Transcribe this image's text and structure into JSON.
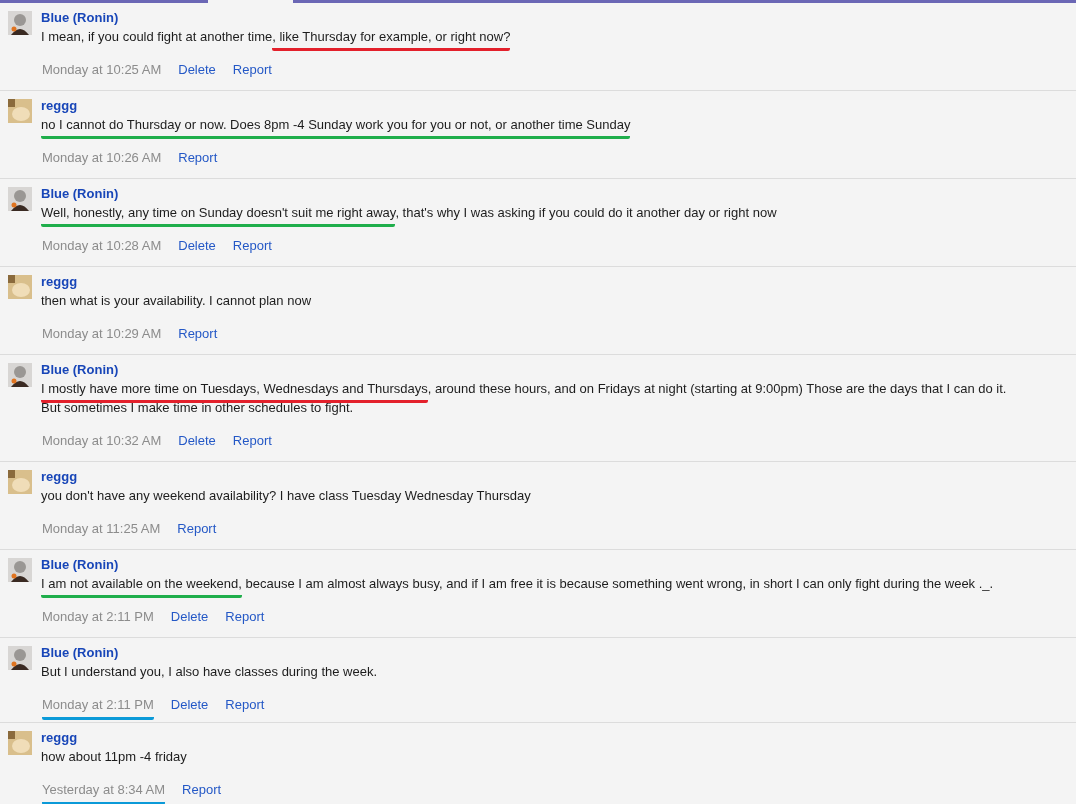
{
  "messages": [
    {
      "author": "Blue (Ronin)",
      "kind": "own",
      "lines": [
        [
          {
            "text": "I mean, if you could fight at another time"
          },
          {
            "text": ", like Thursday for example, or right now?",
            "color": "#e3202b"
          }
        ]
      ],
      "time": {
        "text": "Monday at 10:25 AM"
      },
      "actions": [
        "Delete",
        "Report"
      ]
    },
    {
      "author": "reggg",
      "kind": "other",
      "lines": [
        [
          {
            "text": "no I cannot do Thursday or now. Does 8pm -4 Sunday work you for you or not, or another time Sunday",
            "color": "#1fae4b"
          }
        ]
      ],
      "time": {
        "text": "Monday at 10:26 AM"
      },
      "actions": [
        "Report"
      ]
    },
    {
      "author": "Blue (Ronin)",
      "kind": "own",
      "lines": [
        [
          {
            "text": "Well, honestly, any time on Sunday doesn't suit me right away",
            "color": "#1fae4b"
          },
          {
            "text": ", that's why I was asking if you could do it another day or right now"
          }
        ]
      ],
      "time": {
        "text": "Monday at 10:28 AM"
      },
      "actions": [
        "Delete",
        "Report"
      ]
    },
    {
      "author": "reggg",
      "kind": "other",
      "lines": [
        [
          {
            "text": "then what is your availability. I cannot plan now"
          }
        ]
      ],
      "time": {
        "text": "Monday at 10:29 AM"
      },
      "actions": [
        "Report"
      ]
    },
    {
      "author": "Blue (Ronin)",
      "kind": "own",
      "lines": [
        [
          {
            "text": "I mostly have more time on Tuesdays, Wednesdays and Thursdays",
            "color": "#e3202b"
          },
          {
            "text": ", around these hours, and on Fridays at night (starting at 9:00pm) Those are the days that I can do it."
          }
        ],
        [
          {
            "text": "But sometimes I make time in other schedules to fight."
          }
        ]
      ],
      "time": {
        "text": "Monday at 10:32 AM"
      },
      "actions": [
        "Delete",
        "Report"
      ]
    },
    {
      "author": "reggg",
      "kind": "other",
      "lines": [
        [
          {
            "text": "you don't have any weekend availability? I have class Tuesday Wednesday Thursday"
          }
        ]
      ],
      "time": {
        "text": "Monday at 11:25 AM"
      },
      "actions": [
        "Report"
      ]
    },
    {
      "author": "Blue (Ronin)",
      "kind": "own",
      "lines": [
        [
          {
            "text": "I am not available on the weekend,",
            "color": "#1fae4b"
          },
          {
            "text": " because I am almost always busy, and if I am free it is because something went wrong, in short I can only fight during the week ._."
          }
        ]
      ],
      "time": {
        "text": "Monday at 2:11 PM"
      },
      "actions": [
        "Delete",
        "Report"
      ]
    },
    {
      "author": "Blue (Ronin)",
      "kind": "own",
      "lines": [
        [
          {
            "text": "But I understand you, I also have classes during the week."
          }
        ]
      ],
      "time": {
        "text": "Monday at 2:11 PM",
        "color": "#0b9ad8"
      },
      "actions": [
        "Delete",
        "Report"
      ]
    },
    {
      "author": "reggg",
      "kind": "other",
      "lines": [
        [
          {
            "text": "how about 11pm -4 friday"
          }
        ]
      ],
      "time": {
        "text": "Yesterday at 8:34 AM",
        "color": "#0b9ad8"
      },
      "actions": [
        "Report"
      ]
    }
  ]
}
